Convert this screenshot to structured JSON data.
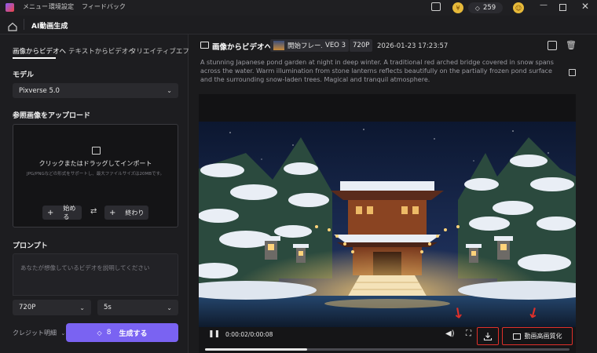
{
  "titlebar": {
    "menu_items": [
      "メニュー",
      "環境設定",
      "フィードバック"
    ],
    "credits": "259",
    "icons": [
      "chat-icon",
      "coin-icon",
      "gem-icon",
      "user-plus-icon",
      "minimize-icon",
      "maximize-icon",
      "close-icon"
    ]
  },
  "header": {
    "title": "AI動画生成"
  },
  "left": {
    "tabs": [
      "画像からビデオへ",
      "テキストからビデオへ",
      "クリエイティブエフェクト"
    ],
    "model_label": "モデル",
    "model_value": "Pixverse 5.0",
    "upload_label": "参照画像をアップロード",
    "upload_main": "クリックまたはドラッグしてインポート",
    "upload_sub": "JPG/PNGなどの形式をサポートし、最大ファイルサイズは20MBです。",
    "start_label": "始める",
    "end_label": "終わり",
    "prompt_label": "プロンプト",
    "prompt_placeholder": "あなたが想像しているビデオを説明してください",
    "resolution": "720P",
    "duration": "5s",
    "credit_detail": "クレジット明細",
    "generate_cost": "8",
    "generate_label": "生成する"
  },
  "right": {
    "title": "画像からビデオへ",
    "tag_start_frame": "開始フレーム",
    "tag_model": "VEO 3",
    "tag_resolution": "720P",
    "timestamp": "2026-01-23 17:23:57",
    "description": "A stunning Japanese pond garden at night in deep winter. A traditional red arched bridge covered in snow spans across the water. Warm illumination from stone lanterns reflects beautifully on the partially frozen pond surface and the surrounding snow-laden trees. Magical and tranquil atmosphere.",
    "time_display": "0:00:02/0:00:08",
    "progress": 0.28,
    "enhance_label": "動画高画質化"
  },
  "colors": {
    "accent": "#7a63f2",
    "highlight_box": "#e0302a"
  }
}
